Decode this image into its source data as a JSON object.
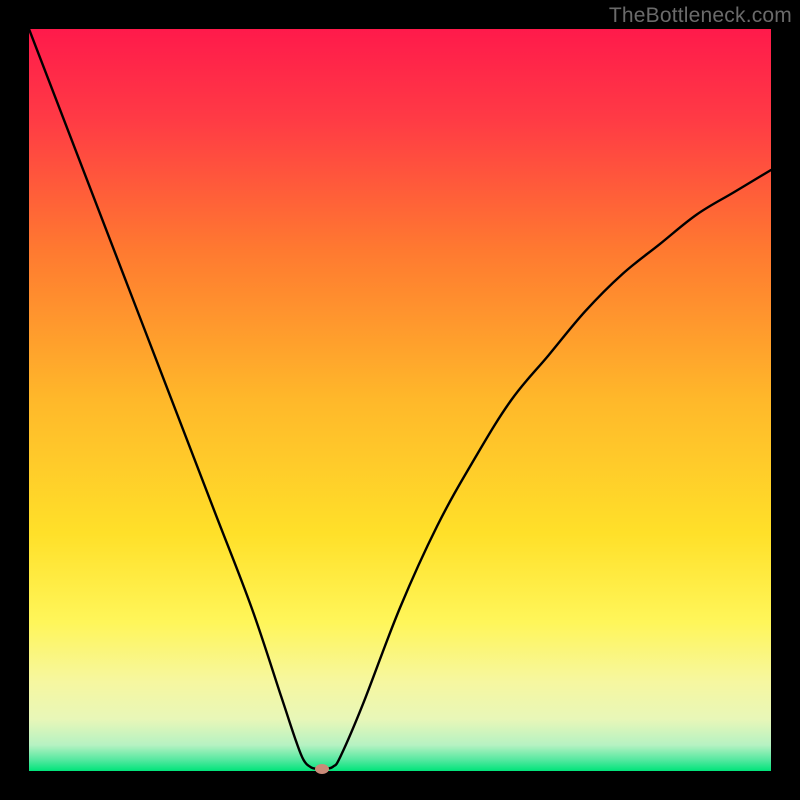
{
  "watermark": "TheBottleneck.com",
  "colors": {
    "top": "#ff1a4b",
    "mid_upper": "#ff8a2a",
    "mid": "#ffde29",
    "mid_lower": "#f6f7a0",
    "bottom": "#00e47a",
    "curve": "#000000",
    "dot": "#c98a78",
    "frame": "#000000"
  },
  "chart_data": {
    "type": "line",
    "title": "",
    "xlabel": "",
    "ylabel": "",
    "xlim": [
      0,
      100
    ],
    "ylim": [
      0,
      100
    ],
    "grid": false,
    "legend": false,
    "annotations": [],
    "series": [
      {
        "name": "curve",
        "x": [
          0,
          5,
          10,
          15,
          20,
          25,
          30,
          34,
          36,
          37,
          38,
          39,
          40,
          41,
          42,
          45,
          50,
          55,
          60,
          65,
          70,
          75,
          80,
          85,
          90,
          95,
          100
        ],
        "values": [
          100,
          87,
          74,
          61,
          48,
          35,
          22,
          10,
          4,
          1.5,
          0.5,
          0.3,
          0.3,
          0.6,
          2,
          9,
          22,
          33,
          42,
          50,
          56,
          62,
          67,
          71,
          75,
          78,
          81
        ]
      }
    ],
    "marker": {
      "x": 39.5,
      "y": 0.3
    },
    "gradient_stops": [
      {
        "offset": 0.0,
        "color": "#ff1a4b"
      },
      {
        "offset": 0.12,
        "color": "#ff3a45"
      },
      {
        "offset": 0.3,
        "color": "#ff7a30"
      },
      {
        "offset": 0.5,
        "color": "#ffb82a"
      },
      {
        "offset": 0.68,
        "color": "#ffe029"
      },
      {
        "offset": 0.8,
        "color": "#fff65a"
      },
      {
        "offset": 0.88,
        "color": "#f6f7a0"
      },
      {
        "offset": 0.93,
        "color": "#e8f7b8"
      },
      {
        "offset": 0.965,
        "color": "#b6f2c2"
      },
      {
        "offset": 0.985,
        "color": "#55e8a0"
      },
      {
        "offset": 1.0,
        "color": "#00e47a"
      }
    ]
  }
}
